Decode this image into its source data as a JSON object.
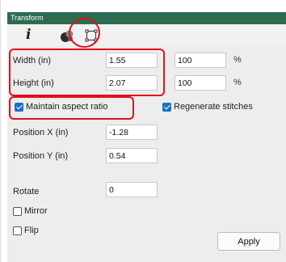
{
  "panel": {
    "title": "Transform"
  },
  "tabs": [
    {
      "name": "info",
      "icon": "info-icon",
      "glyph": "i"
    },
    {
      "name": "color",
      "icon": "color-icon"
    },
    {
      "name": "shape",
      "icon": "shape-icon"
    }
  ],
  "size": {
    "width_label": "Width (in)",
    "width_value": "1.55",
    "width_pct": "100",
    "width_pct_unit": "%",
    "height_label": "Height (in)",
    "height_value": "2.07",
    "height_pct": "100",
    "height_pct_unit": "%"
  },
  "options": {
    "maintain_aspect_label": "Maintain aspect ratio",
    "maintain_aspect_checked": true,
    "regenerate_label": "Regenerate stitches",
    "regenerate_checked": true
  },
  "position": {
    "x_label": "Position X (in)",
    "x_value": "-1.28",
    "y_label": "Position Y (in)",
    "y_value": "0.54"
  },
  "rotate": {
    "label": "Rotate",
    "value": "0"
  },
  "mirror": {
    "label": "Mirror",
    "checked": false
  },
  "flip": {
    "label": "Flip",
    "checked": false
  },
  "actions": {
    "apply_label": "Apply"
  },
  "colors": {
    "title_bar": "#2e6b51",
    "annotation": "#e0101a",
    "checkbox": "#1f6fbf"
  }
}
